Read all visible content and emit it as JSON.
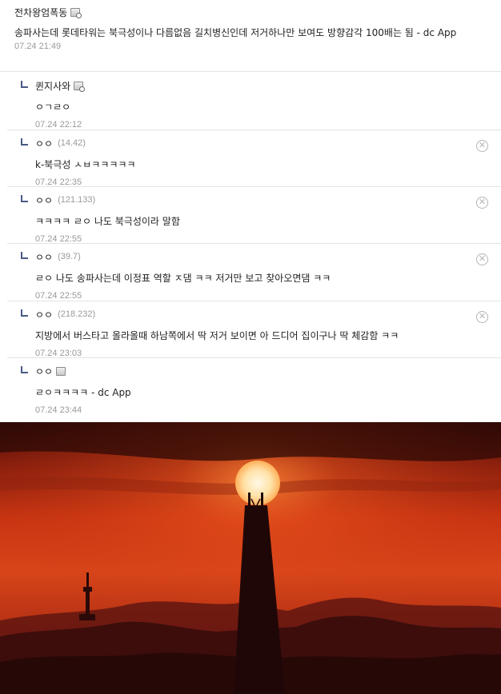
{
  "top_comment": {
    "nickname": "전차왕엄폭동",
    "text": "송파사는데 롯데타워는 북극성이나 다름없음 길치병신인데 저거하나만 보여도 방향감각 100배는 됨 - dc App",
    "date": "07.24 21:49"
  },
  "replies": [
    {
      "nickname": "퀸지사와",
      "ip": "",
      "text": "ㅇㄱㄹㅇ",
      "date": "07.24 22:12",
      "deletable": false,
      "icon": "gallery-user-icon"
    },
    {
      "nickname": "ㅇㅇ",
      "ip": "(14.42)",
      "text": "k-북극성 ㅅㅂㅋㅋㅋㅋㅋ",
      "date": "07.24 22:35",
      "deletable": true,
      "icon": ""
    },
    {
      "nickname": "ㅇㅇ",
      "ip": "(121.133)",
      "text": "ㅋㅋㅋㅋ ㄹㅇ 나도 북극성이라 말함",
      "date": "07.24 22:55",
      "deletable": true,
      "icon": ""
    },
    {
      "nickname": "ㅇㅇ",
      "ip": "(39.7)",
      "text": "ㄹㅇ 나도 송파사는데 이정표 역할 ㅈ댐 ㅋㅋ 저거만 보고 찾아오면댐 ㅋㅋ",
      "date": "07.24 22:55",
      "deletable": true,
      "icon": ""
    },
    {
      "nickname": "ㅇㅇ",
      "ip": "(218.232)",
      "text": "지방에서 버스타고 올라올때 하남쪽에서 딱 저거 보이면 아 드디어 집이구나 딱 체감함 ㅋㅋ",
      "date": "07.24 23:03",
      "deletable": true,
      "icon": ""
    },
    {
      "nickname": "ㅇㅇ",
      "ip": "",
      "text": "ㄹㅇㅋㅋㅋㅋ - dc App",
      "date": "07.24 23:44",
      "deletable": false,
      "icon": "half-fixed-user-icon"
    }
  ],
  "delete_glyph": "✕",
  "photo": {
    "icon": "sunset-tower-photo",
    "sky_color": "#d43a12",
    "sun_color": "#fff4d8",
    "silhouette_color": "#2a0a08"
  }
}
